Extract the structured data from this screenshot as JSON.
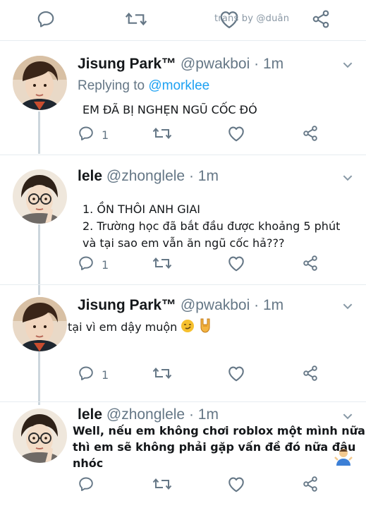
{
  "watermark": "trans by @duân",
  "tweets": [
    {
      "name": "Jisung Park™",
      "handle": "@pwakboi",
      "time": "· 1m",
      "replying_prefix": "Replying to",
      "replying_handle": "@morklee",
      "text": [
        "EM ĐÃ BỊ NGHẸN NGŨ CỐC ĐÓ"
      ],
      "reply_count": "1",
      "avatar": "jisung-avatar"
    },
    {
      "name": "lele",
      "handle": "@zhonglele",
      "time": "· 1m",
      "text": [
        "1. ỒN THÔI ANH GIAI",
        "2. Trường học đã bắt đầu được khoảng 5 phút",
        "và tại sao em vẫn ăn ngũ cốc hả???"
      ],
      "reply_count": "1",
      "avatar": "lele-avatar"
    },
    {
      "name": "Jisung Park™",
      "handle": "@pwakboi",
      "time": "· 1m",
      "text": [
        "tại vì em dậy muộn"
      ],
      "emojis": [
        "smirk-emoji",
        "rock-hand-emoji"
      ],
      "reply_count": "1",
      "avatar": "jisung-avatar"
    },
    {
      "name": "lele",
      "handle": "@zhonglele",
      "time": "· 1m",
      "text": [
        "Well, nếu em không chơi roblox một mình nữa",
        "thì em sẽ không phải gặp vấn đề đó nữa đâu",
        "nhóc"
      ],
      "emojis": [
        "shrug-emoji"
      ],
      "avatar": "lele-avatar"
    }
  ],
  "icons": {
    "reply": "reply-icon",
    "retweet": "retweet-icon",
    "like": "heart-icon",
    "share": "share-icon",
    "more": "chevron-down-icon"
  },
  "colors": {
    "icon_gray": "#657786",
    "mention_blue": "#1da1f2",
    "thread_line": "#ccd6dd"
  }
}
